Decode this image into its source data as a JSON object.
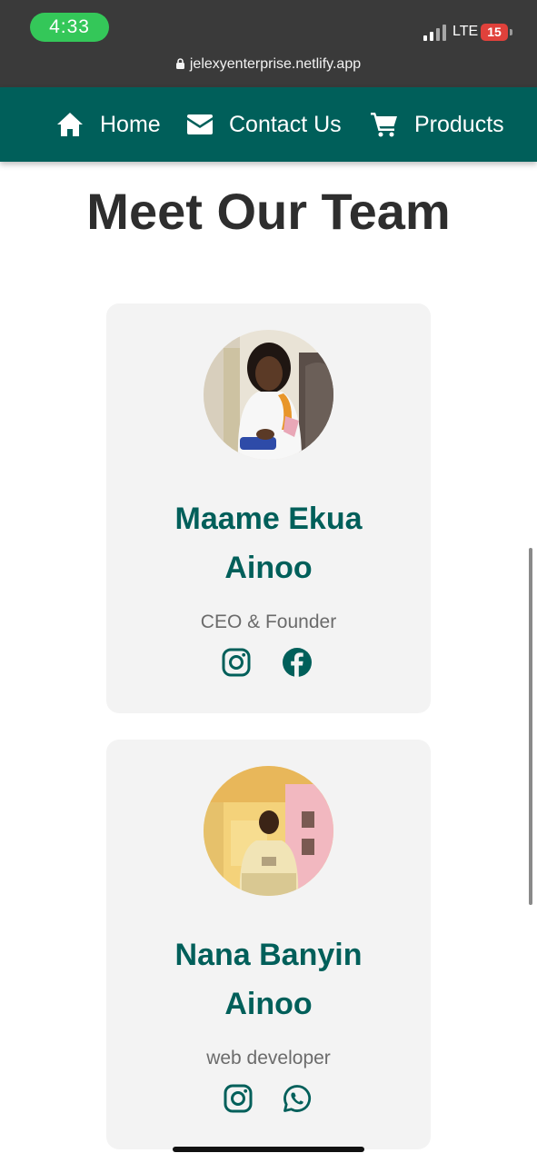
{
  "status_bar": {
    "time": "4:33",
    "network": "LTE",
    "battery": "15",
    "url": "jelexyenterprise.netlify.app"
  },
  "nav": {
    "items": [
      {
        "label": "Home",
        "icon": "home-icon"
      },
      {
        "label": "Contact Us",
        "icon": "envelope-icon"
      },
      {
        "label": "Products",
        "icon": "cart-icon"
      }
    ]
  },
  "page": {
    "title": "Meet Our Team"
  },
  "team": [
    {
      "name_line1": "Maame Ekua",
      "name_line2": "Ainoo",
      "role": "CEO & Founder",
      "socials": [
        "instagram-icon",
        "facebook-icon"
      ]
    },
    {
      "name_line1": "Nana Banyin",
      "name_line2": "Ainoo",
      "role": "web developer",
      "socials": [
        "instagram-icon",
        "whatsapp-icon"
      ]
    }
  ],
  "colors": {
    "brand": "#005f5a",
    "status_bar": "#3a3a3a",
    "card_bg": "#f3f3f3"
  }
}
